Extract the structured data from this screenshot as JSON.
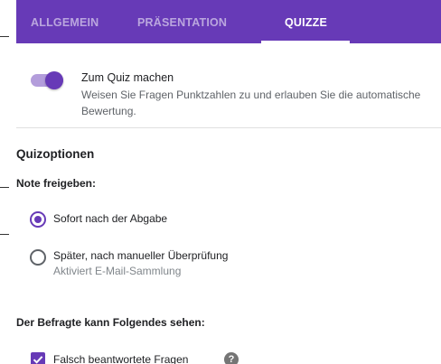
{
  "tabs": [
    {
      "label": "ALLGEMEIN",
      "active": false
    },
    {
      "label": "PRÄSENTATION",
      "active": false
    },
    {
      "label": "QUIZZE",
      "active": true
    }
  ],
  "quiz_toggle": {
    "title": "Zum Quiz machen",
    "description": "Weisen Sie Fragen Punktzahlen zu und erlauben Sie die automatische Bewertung.",
    "on": true
  },
  "quiz_options": {
    "title": "Quizoptionen",
    "release_grade": {
      "label": "Note freigeben:",
      "options": [
        {
          "label": "Sofort nach der Abgabe",
          "selected": true,
          "sublabel": ""
        },
        {
          "label": "Später, nach manueller Überprüfung",
          "selected": false,
          "sublabel": "Aktiviert E-Mail-Sammlung"
        }
      ]
    },
    "respondent_can_see": {
      "label": "Der Befragte kann Folgendes sehen:",
      "items": [
        {
          "label": "Falsch beantwortete Fragen",
          "checked": true
        }
      ]
    }
  },
  "icons": {
    "help": "help-circle-icon",
    "help_glyph": "?",
    "check": "check-icon"
  },
  "colors": {
    "accent": "#673ab7",
    "accent_light": "#b39ddb",
    "text": "#202124",
    "text_secondary": "#5f6368"
  }
}
